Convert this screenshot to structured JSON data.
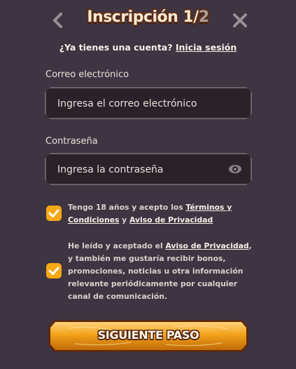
{
  "header": {
    "title_main": "Inscripción 1",
    "title_sep": "/",
    "title_total": "2",
    "back_icon": "chevron-left-icon",
    "close_icon": "close-icon"
  },
  "login_prompt": {
    "text": "¿Ya tienes una cuenta?",
    "link": "Inicia sesión"
  },
  "email": {
    "label": "Correo electrónico",
    "placeholder": "Ingresa el correo electrónico",
    "value": ""
  },
  "password": {
    "label": "Contraseña",
    "placeholder": "Ingresa la contraseña",
    "value": "",
    "toggle_icon": "eye-icon"
  },
  "consents": {
    "terms": {
      "checked": true,
      "prefix": "Tengo 18 años y acepto los ",
      "link1": "Términos y Condiciones",
      "middle": " y ",
      "link2": "Aviso de Privacidad"
    },
    "marketing": {
      "checked": true,
      "prefix": "He leído y aceptado el ",
      "link": "Aviso de Privacidad",
      "suffix": ", y también me gustaría recibir bonos, promociones, noticias u otra información relevante periódicamente por cualquier canal de comunicación."
    }
  },
  "submit": {
    "label": "SIGUIENTE PASO"
  },
  "colors": {
    "background": "#3e3542",
    "accent": "#f6a814",
    "input_bg": "#2a2229"
  }
}
